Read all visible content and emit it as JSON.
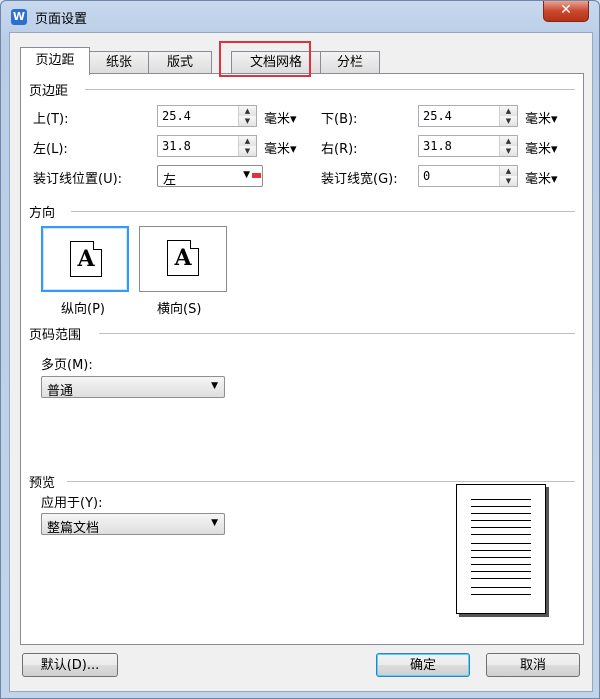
{
  "window": {
    "title": "页面设置",
    "app_icon_letter": "W",
    "close": "✕"
  },
  "tabs": [
    "页边距",
    "纸张",
    "版式",
    "文档网格",
    "分栏"
  ],
  "margins": {
    "section": "页边距",
    "top": {
      "label": "上(T):",
      "value": "25.4",
      "unit": "毫米▾"
    },
    "bottom": {
      "label": "下(B):",
      "value": "25.4",
      "unit": "毫米▾"
    },
    "left": {
      "label": "左(L):",
      "value": "31.8",
      "unit": "毫米▾"
    },
    "right": {
      "label": "右(R):",
      "value": "31.8",
      "unit": "毫米▾"
    },
    "gutter_pos": {
      "label": "装订线位置(U):",
      "value": "左"
    },
    "gutter_width": {
      "label": "装订线宽(G):",
      "value": "0",
      "unit": "毫米▾"
    }
  },
  "orientation": {
    "section": "方向",
    "portrait": {
      "label": "纵向(P)",
      "glyph": "A"
    },
    "landscape": {
      "label": "横向(S)",
      "glyph": "A"
    }
  },
  "page_range": {
    "section": "页码范围",
    "multi_label": "多页(M):",
    "multi_value": "普通"
  },
  "preview": {
    "section": "预览",
    "apply_label": "应用于(Y):",
    "apply_value": "整篇文档"
  },
  "buttons": {
    "default": "默认(D)...",
    "ok": "确定",
    "cancel": "取消"
  }
}
